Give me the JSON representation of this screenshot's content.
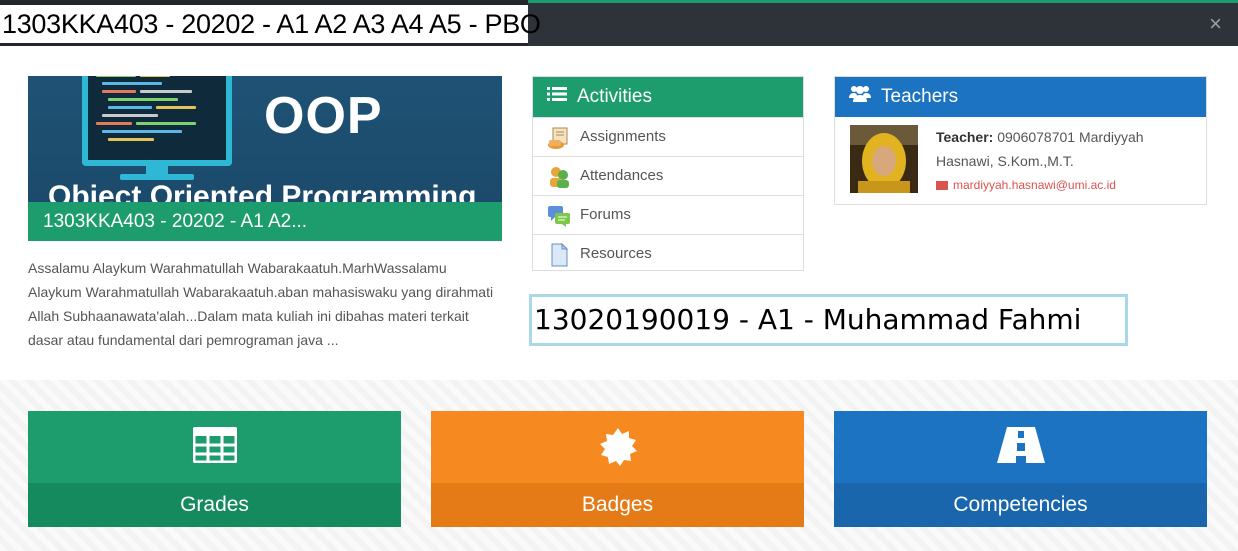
{
  "header": {
    "title": "1303KKA403 - 20202 - A1 A2 A3 A4 A5 - PBO",
    "close_icon": "×"
  },
  "course": {
    "image_text": "OOP",
    "image_subtext": "Object Oriented Programming",
    "name_bar": "1303KKA403 - 20202 - A1 A2...",
    "summary": "Assalamu Alaykum Warahmatullah Wabarakaatuh.MarhWassalamu Alaykum Warahmatullah Wabarakaatuh.aban mahasiswaku yang dirahmati Allah Subhaanawata'alah...Dalam mata kuliah ini dibahas materi terkait dasar atau fundamental dari pemrograman java ..."
  },
  "activities": {
    "title": "Activities",
    "icon": "list-icon",
    "items": [
      {
        "label": "Assignments",
        "icon": "assignment-icon"
      },
      {
        "label": "Attendances",
        "icon": "attendance-icon"
      },
      {
        "label": "Forums",
        "icon": "forum-icon"
      },
      {
        "label": "Resources",
        "icon": "resource-icon"
      }
    ]
  },
  "teachers": {
    "title": "Teachers",
    "icon": "users-icon",
    "teacher_label": "Teacher:",
    "teacher_text": " 0906078701 Mardiyyah Hasnawi, S.Kom.,M.T.",
    "email": "mardiyyah.hasnawi@umi.ac.id"
  },
  "student": {
    "label": "13020190019 - A1 - Muhammad Fahmi"
  },
  "tiles": {
    "grades": {
      "label": "Grades",
      "icon": "table-icon"
    },
    "badges": {
      "label": "Badges",
      "icon": "badge-icon"
    },
    "competencies": {
      "label": "Competencies",
      "icon": "road-icon"
    }
  },
  "colors": {
    "green": "#1d9d6d",
    "orange": "#f68a20",
    "blue": "#1b73c2",
    "topbar": "#2d3339"
  }
}
